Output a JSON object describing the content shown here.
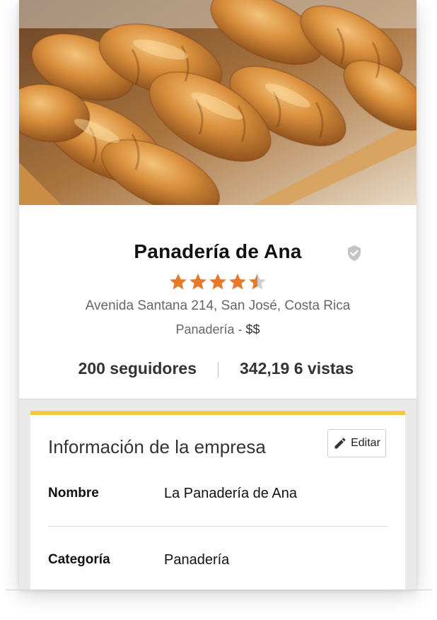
{
  "business": {
    "name": "Panadería de Ana",
    "rating": 4.5,
    "rating_max": 5,
    "address": "Avenida Santana 214, San José, Costa Rica",
    "category": "Panadería",
    "separator": " - ",
    "price_level": "$$",
    "followers": "200 seguidores",
    "views": "342,19 6 vistas"
  },
  "info_section": {
    "title": "Información de la empresa",
    "edit_label": "Editar",
    "rows": [
      {
        "label": "Nombre",
        "value": "La Panadería de Ana"
      },
      {
        "label": "Categoría",
        "value": "Panadería"
      }
    ]
  },
  "colors": {
    "star": "#e8782a",
    "star_empty": "#cfcfcf",
    "accent_bar": "#f5c842",
    "verified": "#c4c4c4"
  },
  "icons": {
    "verified": "shield-check-icon",
    "edit": "pencil-icon",
    "star": "star-icon"
  }
}
